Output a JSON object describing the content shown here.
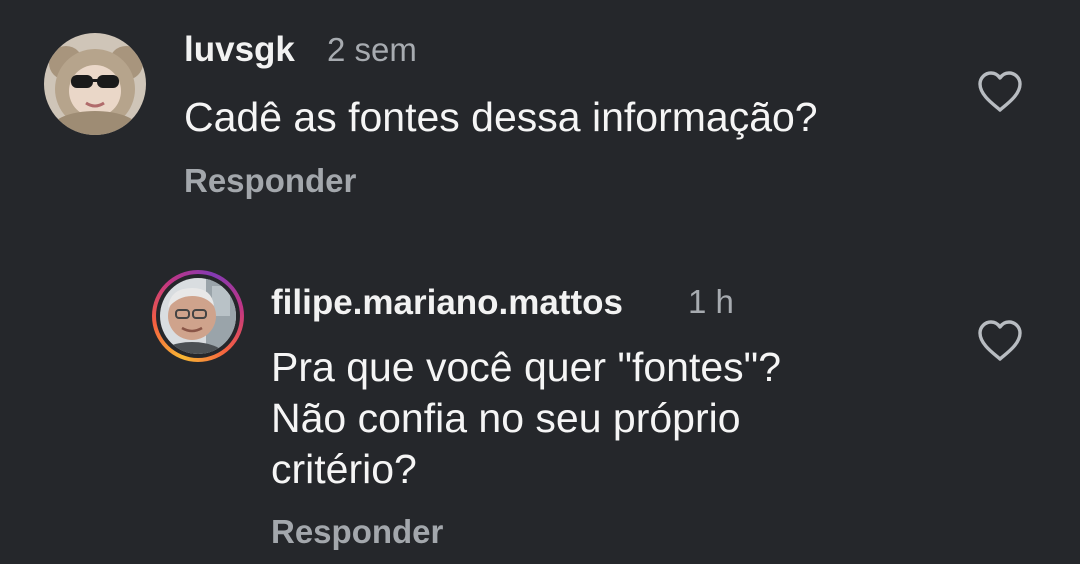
{
  "comments": [
    {
      "username": "luvsgk",
      "time": "2 sem",
      "text": "Cadê as fontes dessa informação?",
      "reply_label": "Responder",
      "like_icon": "heart-outline-icon"
    },
    {
      "username": "filipe.mariano.mattos",
      "time": "1 h",
      "text": "Pra que você quer \"fontes\"?\nNão confia no seu próprio\ncritério?",
      "reply_label": "Responder",
      "like_icon": "heart-outline-icon",
      "has_story_ring": true
    }
  ],
  "colors": {
    "background": "#25272b",
    "text_primary": "#f5f5f5",
    "text_secondary": "#a7abb0",
    "story_ring": [
      "#f7b733",
      "#f56040",
      "#c13584",
      "#833ab4"
    ]
  }
}
